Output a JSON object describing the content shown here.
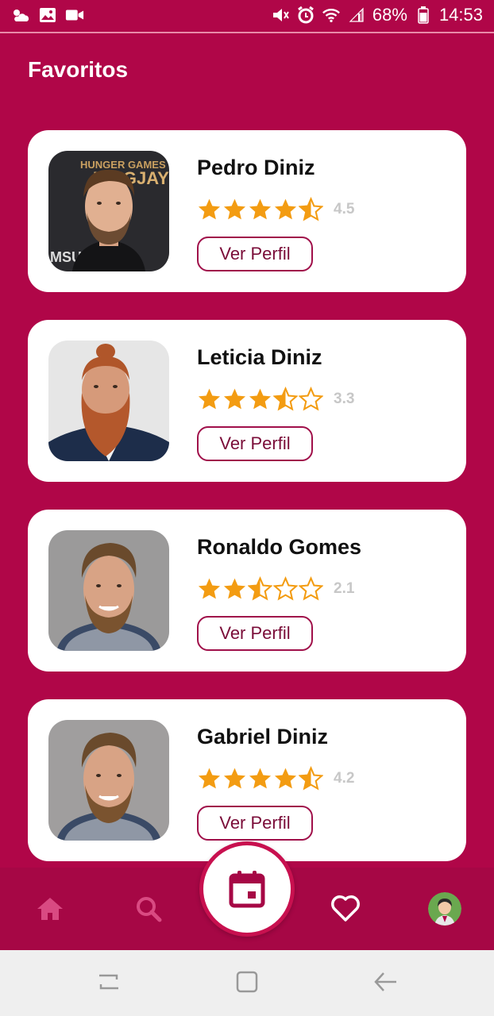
{
  "status_bar": {
    "battery": "68%",
    "time": "14:53",
    "left_icons": [
      "weather-icon",
      "gallery-icon",
      "video-icon"
    ],
    "right_icons": [
      "mute-icon",
      "alarm-icon",
      "wifi-icon",
      "signal-icon",
      "battery-icon"
    ]
  },
  "header": {
    "title": "Favoritos"
  },
  "favorites": [
    {
      "name": "Pedro Diniz",
      "rating": "4.5",
      "rating_value": 4.5,
      "button": "Ver Perfil"
    },
    {
      "name": "Leticia Diniz",
      "rating": "3.3",
      "rating_value": 3.3,
      "button": "Ver Perfil"
    },
    {
      "name": "Ronaldo Gomes",
      "rating": "2.1",
      "rating_value": 2.1,
      "button": "Ver Perfil"
    },
    {
      "name": "Gabriel Diniz",
      "rating": "4.2",
      "rating_value": 4.2,
      "button": "Ver Perfil"
    }
  ],
  "bottom_nav": {
    "items": [
      "home-icon",
      "search-icon",
      "calendar-icon",
      "heart-icon",
      "profile-avatar"
    ],
    "active": "heart-icon"
  },
  "colors": {
    "primary": "#b00648",
    "nav": "#a60745",
    "star": "#f39c12",
    "button_border": "#a0104a"
  }
}
